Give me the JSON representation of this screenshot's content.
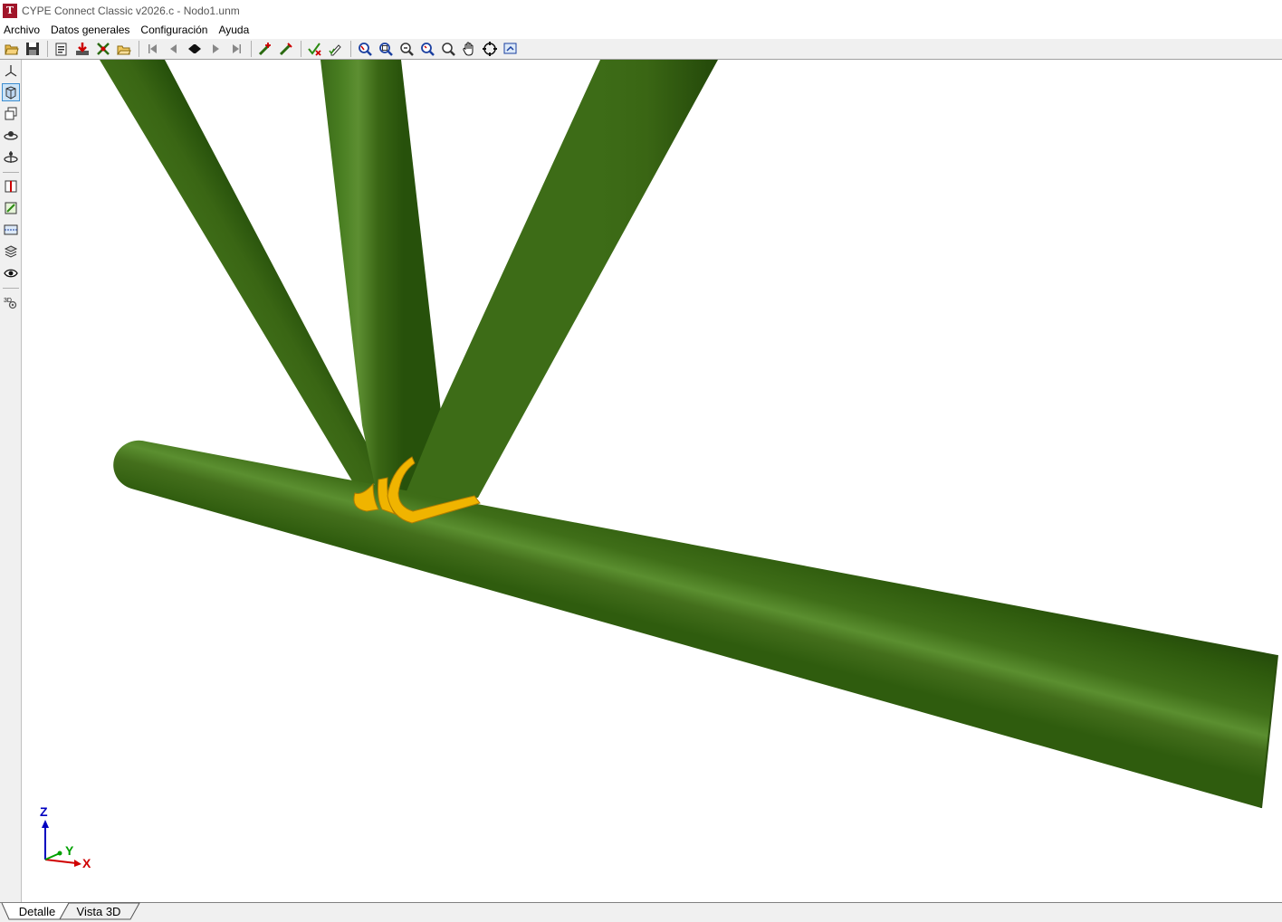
{
  "window": {
    "title": "CYPE Connect Classic v2026.c - Nodo1.unm",
    "app_icon_glyph": "T"
  },
  "menu": [
    {
      "label": "Archivo"
    },
    {
      "label": "Datos generales"
    },
    {
      "label": "Configuración"
    },
    {
      "label": "Ayuda"
    }
  ],
  "toolbar": {
    "icons": [
      "open-folder-icon",
      "save-icon",
      "project-data-icon",
      "import-icon",
      "members-icon",
      "open-file-icon",
      "first-node-icon",
      "previous-node-icon",
      "select-node-icon",
      "next-node-icon",
      "last-node-icon",
      "add-member-icon",
      "edit-member-icon",
      "check-icon",
      "pencil-check-icon",
      "zoom-window-icon",
      "zoom-all-icon",
      "zoom-previous-icon",
      "zoom-refresh-icon",
      "zoom-out-icon",
      "pan-hand-icon",
      "orbit-icon",
      "export-view-icon"
    ]
  },
  "sidebar": {
    "icons": [
      "axes-view-icon",
      "solid-view-icon",
      "wireframe-view-icon",
      "rotate-view-icon",
      "orbit-axis-icon",
      "plates-color-icon",
      "plates-edit-icon",
      "section-view-icon",
      "layers-icon",
      "visibility-icon",
      "3d-options-icon"
    ],
    "active": "solid-view-icon"
  },
  "axes": {
    "x": "X",
    "y": "Y",
    "z": "Z"
  },
  "tabs": [
    {
      "label": "Detalle"
    },
    {
      "label": "Vista 3D"
    }
  ],
  "colors": {
    "member_dark": "#2a4f0d",
    "member_mid": "#3a6614",
    "member_light": "#5b8f30",
    "weld": "#f0b400",
    "axis_x": "#d00000",
    "axis_y": "#00a000",
    "axis_z": "#0000c0"
  }
}
